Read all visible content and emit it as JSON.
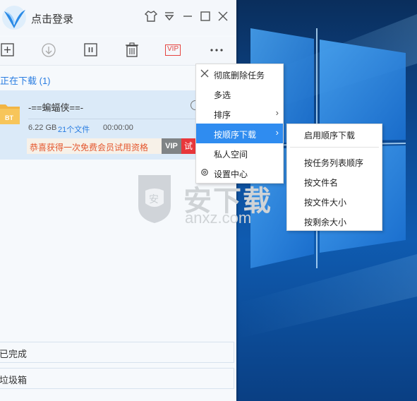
{
  "window": {
    "login_label": "点击登录"
  },
  "titlebar_icons": [
    "skin-icon",
    "menu-dropdown-icon",
    "minimize-icon",
    "maximize-icon",
    "close-icon"
  ],
  "toolbar": {
    "vip_label": "VIP"
  },
  "downloads": {
    "section_label": "正在下载 (1)",
    "item": {
      "badge": "BT",
      "name": "-==蝙蝠侠==-",
      "size": "6.22 GB",
      "file_count": "21个文件",
      "time": "00:00:00"
    },
    "promo": {
      "text": "恭喜获得一次免费会员试用资格",
      "vip_badge": "VIP",
      "try_label": "试"
    }
  },
  "sidebar_bottom": {
    "completed": "已完成",
    "trash": "垃圾箱"
  },
  "watermark": {
    "cn": "安下载",
    "en": "anxz.com",
    "shield_char": "安"
  },
  "context_menu": {
    "items": [
      {
        "label": "彻底删除任务",
        "icon": "close-icon"
      },
      {
        "label": "多选"
      },
      {
        "label": "排序",
        "submenu": true
      },
      {
        "label": "按顺序下载",
        "submenu": true,
        "active": true
      },
      {
        "label": "私人空间"
      },
      {
        "label": "设置中心",
        "icon": "gear-icon"
      }
    ],
    "accent": "#2f8cf0"
  },
  "submenu": {
    "items": [
      {
        "label": "启用顺序下载"
      },
      {
        "label": "按任务列表顺序"
      },
      {
        "label": "按文件名"
      },
      {
        "label": "按文件大小"
      },
      {
        "label": "按剩余大小"
      }
    ]
  }
}
